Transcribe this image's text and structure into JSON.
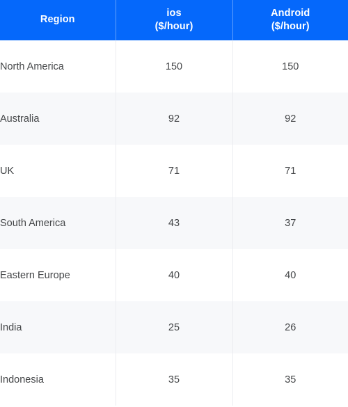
{
  "table": {
    "columns": [
      {
        "key": "region",
        "label": "Region",
        "sublabel": ""
      },
      {
        "key": "ios",
        "label": "ios",
        "sublabel": "($/hour)"
      },
      {
        "key": "android",
        "label": "Android",
        "sublabel": "($/hour)"
      }
    ],
    "rows": [
      {
        "region": "North America",
        "ios": "150",
        "android": "150"
      },
      {
        "region": "Australia",
        "ios": "92",
        "android": "92"
      },
      {
        "region": "UK",
        "ios": "71",
        "android": "71"
      },
      {
        "region": "South America",
        "ios": "43",
        "android": "37"
      },
      {
        "region": "Eastern Europe",
        "ios": "40",
        "android": "40"
      },
      {
        "region": "India",
        "ios": "25",
        "android": "26"
      },
      {
        "region": "Indonesia",
        "ios": "35",
        "android": "35"
      }
    ]
  },
  "chart_data": {
    "type": "table",
    "title": "",
    "categories": [
      "North America",
      "Australia",
      "UK",
      "South America",
      "Eastern Europe",
      "India",
      "Indonesia"
    ],
    "series": [
      {
        "name": "ios ($/hour)",
        "values": [
          150,
          92,
          71,
          43,
          40,
          25,
          35
        ]
      },
      {
        "name": "Android ($/hour)",
        "values": [
          150,
          92,
          71,
          37,
          40,
          26,
          35
        ]
      }
    ],
    "xlabel": "Region",
    "ylabel": "$/hour",
    "legend": [
      "ios ($/hour)",
      "Android ($/hour)"
    ],
    "grid": false
  },
  "colors": {
    "header_background": "#0568fb",
    "header_text": "#ffffff",
    "row_background": "#ffffff",
    "row_background_alt": "#f7f8fa",
    "body_text": "#444648",
    "divider": "#ebecf0"
  }
}
